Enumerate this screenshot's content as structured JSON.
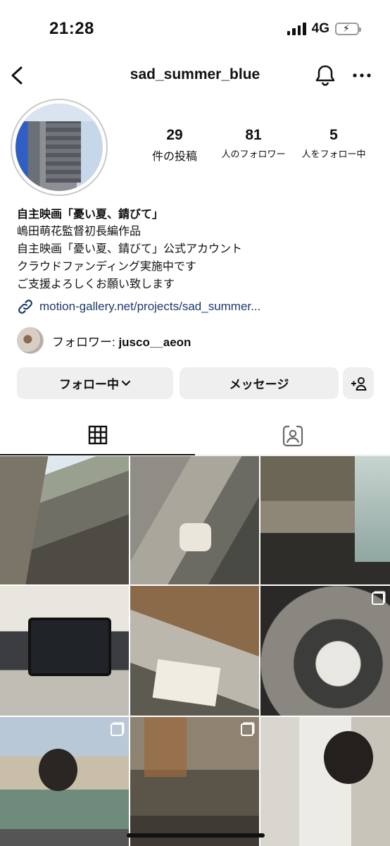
{
  "status_bar": {
    "time": "21:28",
    "network": "4G"
  },
  "header": {
    "username": "sad_summer_blue"
  },
  "stats": {
    "posts": {
      "value": "29",
      "label": "件の投稿"
    },
    "followers": {
      "value": "81",
      "label": "人のフォロワー"
    },
    "following": {
      "value": "5",
      "label": "人をフォロー中"
    }
  },
  "bio": {
    "name": "自主映画「憂い夏、錆びて」",
    "lines": [
      "嶋田萌花監督初長編作品",
      "自主映画「憂い夏、錆びて」公式アカウント",
      "クラウドファンディング実施中です",
      "ご支援よろしくお願い致します"
    ],
    "link": "motion-gallery.net/projects/sad_summer..."
  },
  "followed_by": {
    "prefix": "フォロワー: ",
    "user": "jusco__aeon"
  },
  "actions": {
    "follow": "フォロー中",
    "message": "メッセージ"
  },
  "icons": [
    "back-icon",
    "bell-icon",
    "more-icon",
    "link-icon",
    "chevron-down-icon",
    "add-user-icon",
    "grid-icon",
    "tagged-icon",
    "multi-post-icon"
  ],
  "photos": [
    {
      "multi": false
    },
    {
      "multi": false
    },
    {
      "multi": false
    },
    {
      "multi": false
    },
    {
      "multi": false
    },
    {
      "multi": true
    },
    {
      "multi": true
    },
    {
      "multi": true
    },
    {
      "multi": false
    }
  ]
}
